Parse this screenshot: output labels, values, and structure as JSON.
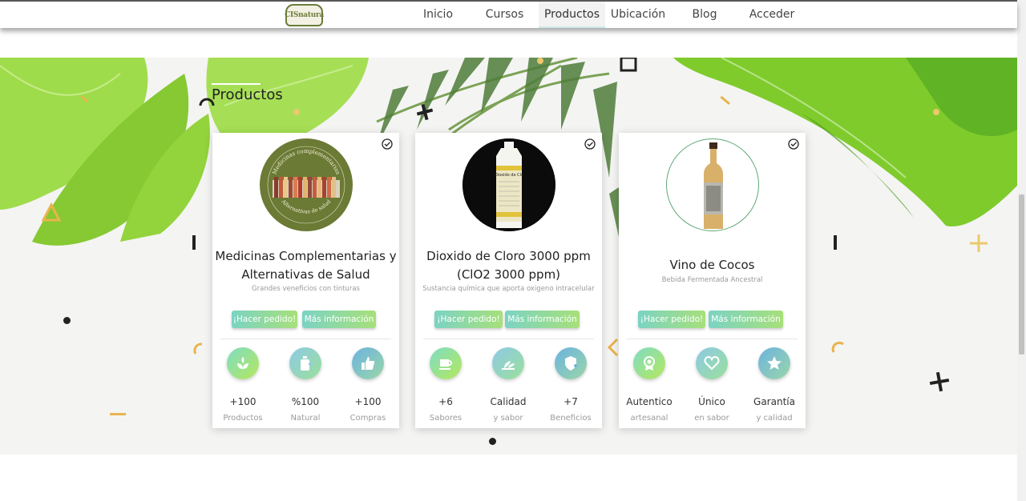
{
  "nav": {
    "logo_text": "CISnatura",
    "items": [
      {
        "label": "Inicio",
        "active": false
      },
      {
        "label": "Cursos",
        "active": false
      },
      {
        "label": "Productos",
        "active": true
      },
      {
        "label": "Ubicación",
        "active": false
      },
      {
        "label": "Blog",
        "active": false
      },
      {
        "label": "Acceder",
        "active": false
      }
    ]
  },
  "section": {
    "title": "Productos"
  },
  "colors": {
    "accent_from": "#7bd3c3",
    "accent_to": "#a7e07a",
    "leaf_green": "#8ccf3a"
  },
  "cards": [
    {
      "name_line1": "Medicinas Complementarias y",
      "name_line2": "Alternativas de Salud",
      "subtitle": "Grandes veneficios con tinturas",
      "image_text_top": "Medicinas complementarias",
      "image_text_bottom": "Alternativas de salud",
      "order_button": "¡Hacer pedido!",
      "info_button": "Más información",
      "features": [
        {
          "icon": "plant-icon",
          "value": "+100",
          "label": "Productos"
        },
        {
          "icon": "bottle-icon",
          "value": "%100",
          "label": "Natural"
        },
        {
          "icon": "thumbs-up-icon",
          "value": "+100",
          "label": "Compras"
        }
      ]
    },
    {
      "name_line1": "Dioxido de Cloro 3000 ppm",
      "name_line2": "(ClO2 3000 ppm)",
      "subtitle": "Sustancia química que aporta oxigeno intracelular",
      "image_text_top": "Dioxido de Clo",
      "image_text_bottom": "",
      "order_button": "¡Hacer pedido!",
      "info_button": "Más información",
      "features": [
        {
          "icon": "cup-icon",
          "value": "+6",
          "label": "Sabores"
        },
        {
          "icon": "leaf-icon",
          "value": "Calidad",
          "label": "y sabor"
        },
        {
          "icon": "shield-plus-icon",
          "value": "+7",
          "label": "Beneficios"
        }
      ]
    },
    {
      "name_line1": "Vino de Cocos",
      "name_line2": "",
      "subtitle": "Bebida Fermentada Ancestral",
      "image_text_top": "",
      "image_text_bottom": "",
      "order_button": "¡Hacer pedido!",
      "info_button": "Más información",
      "features": [
        {
          "icon": "award-icon",
          "value": "Autentico",
          "label": "artesanal"
        },
        {
          "icon": "heart-icon",
          "value": "Único",
          "label": "en sabor"
        },
        {
          "icon": "star-icon",
          "value": "Garantía",
          "label": "y calidad"
        }
      ]
    }
  ]
}
